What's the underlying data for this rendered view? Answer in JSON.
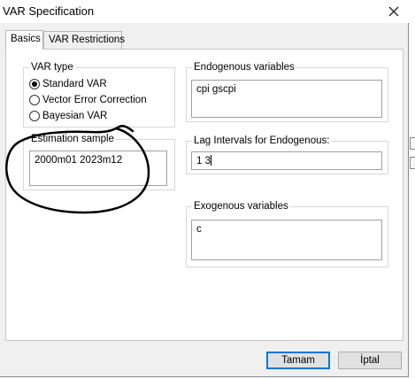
{
  "window": {
    "title": "VAR Specification",
    "close_icon": "close-icon"
  },
  "tabs": [
    {
      "label": "Basics",
      "active": true
    },
    {
      "label": "VAR Restrictions",
      "active": false
    }
  ],
  "var_type": {
    "label": "VAR type",
    "options": [
      {
        "label": "Standard VAR",
        "selected": true
      },
      {
        "label": "Vector Error Correction",
        "selected": false
      },
      {
        "label": "Bayesian VAR",
        "selected": false
      }
    ]
  },
  "estimation_sample": {
    "label": "Estimation sample",
    "value": "2000m01 2023m12"
  },
  "endogenous": {
    "label": "Endogenous variables",
    "value": "cpi gscpi"
  },
  "lag_intervals": {
    "label": "Lag Intervals for Endogenous:",
    "value": "1 3"
  },
  "exogenous": {
    "label": "Exogenous variables",
    "value": "c"
  },
  "buttons": {
    "ok": "Tamam",
    "cancel": "İptal"
  },
  "annotation": {
    "color": "#000000"
  }
}
